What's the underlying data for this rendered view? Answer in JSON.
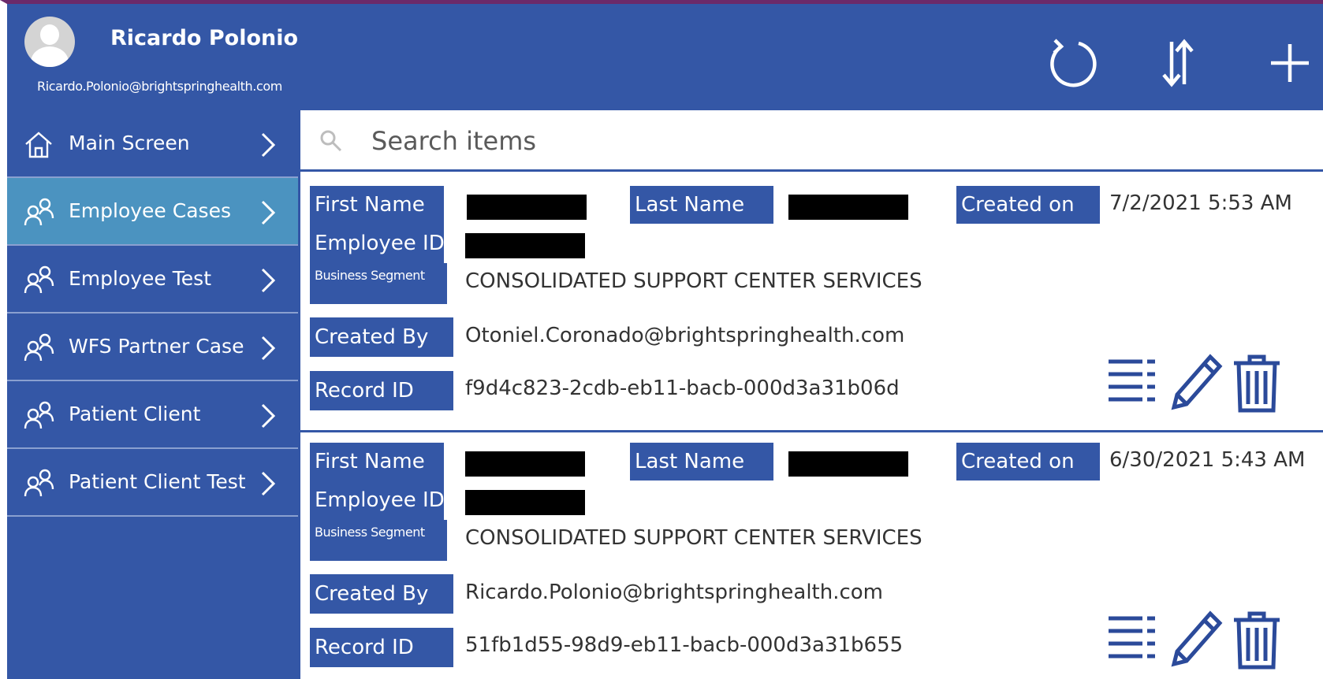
{
  "header": {
    "user_name": "Ricardo Polonio",
    "user_email": "Ricardo.Polonio@brightspringhealth.com",
    "buttons": {
      "refresh": "refresh-icon",
      "sort": "sort-icon",
      "add": "plus-icon"
    }
  },
  "sidebar": {
    "items": [
      {
        "label": "Main Screen",
        "icon": "home-icon",
        "active": false
      },
      {
        "label": "Employee Cases",
        "icon": "people-icon",
        "active": true
      },
      {
        "label": "Employee Test",
        "icon": "people-icon",
        "active": false
      },
      {
        "label": "WFS Partner Case",
        "icon": "people-icon",
        "active": false
      },
      {
        "label": "Patient Client",
        "icon": "people-icon",
        "active": false
      },
      {
        "label": "Patient Client Test",
        "icon": "people-icon",
        "active": false
      }
    ]
  },
  "search": {
    "placeholder": "Search items",
    "value": ""
  },
  "labels": {
    "first_name": "First Name",
    "last_name": "Last Name",
    "created_on": "Created on",
    "employee_id": "Employee ID",
    "business_segment": "Business Segment",
    "created_by": "Created By",
    "record_id": "Record ID"
  },
  "records": [
    {
      "created_on": "7/2/2021 5:53 AM",
      "business_segment": "CONSOLIDATED SUPPORT CENTER SERVICES",
      "created_by": "Otoniel.Coronado@brightspringhealth.com",
      "record_id": "f9d4c823-2cdb-eb11-bacb-000d3a31b06d"
    },
    {
      "created_on": "6/30/2021 5:43 AM",
      "business_segment": "CONSOLIDATED SUPPORT CENTER SERVICES",
      "created_by": "Ricardo.Polonio@brightspringhealth.com",
      "record_id": "51fb1d55-98d9-eb11-bacb-000d3a31b655"
    }
  ],
  "colors": {
    "primary": "#3457a6",
    "active": "#4b93c0",
    "icon_dark": "#2b4a9a"
  }
}
